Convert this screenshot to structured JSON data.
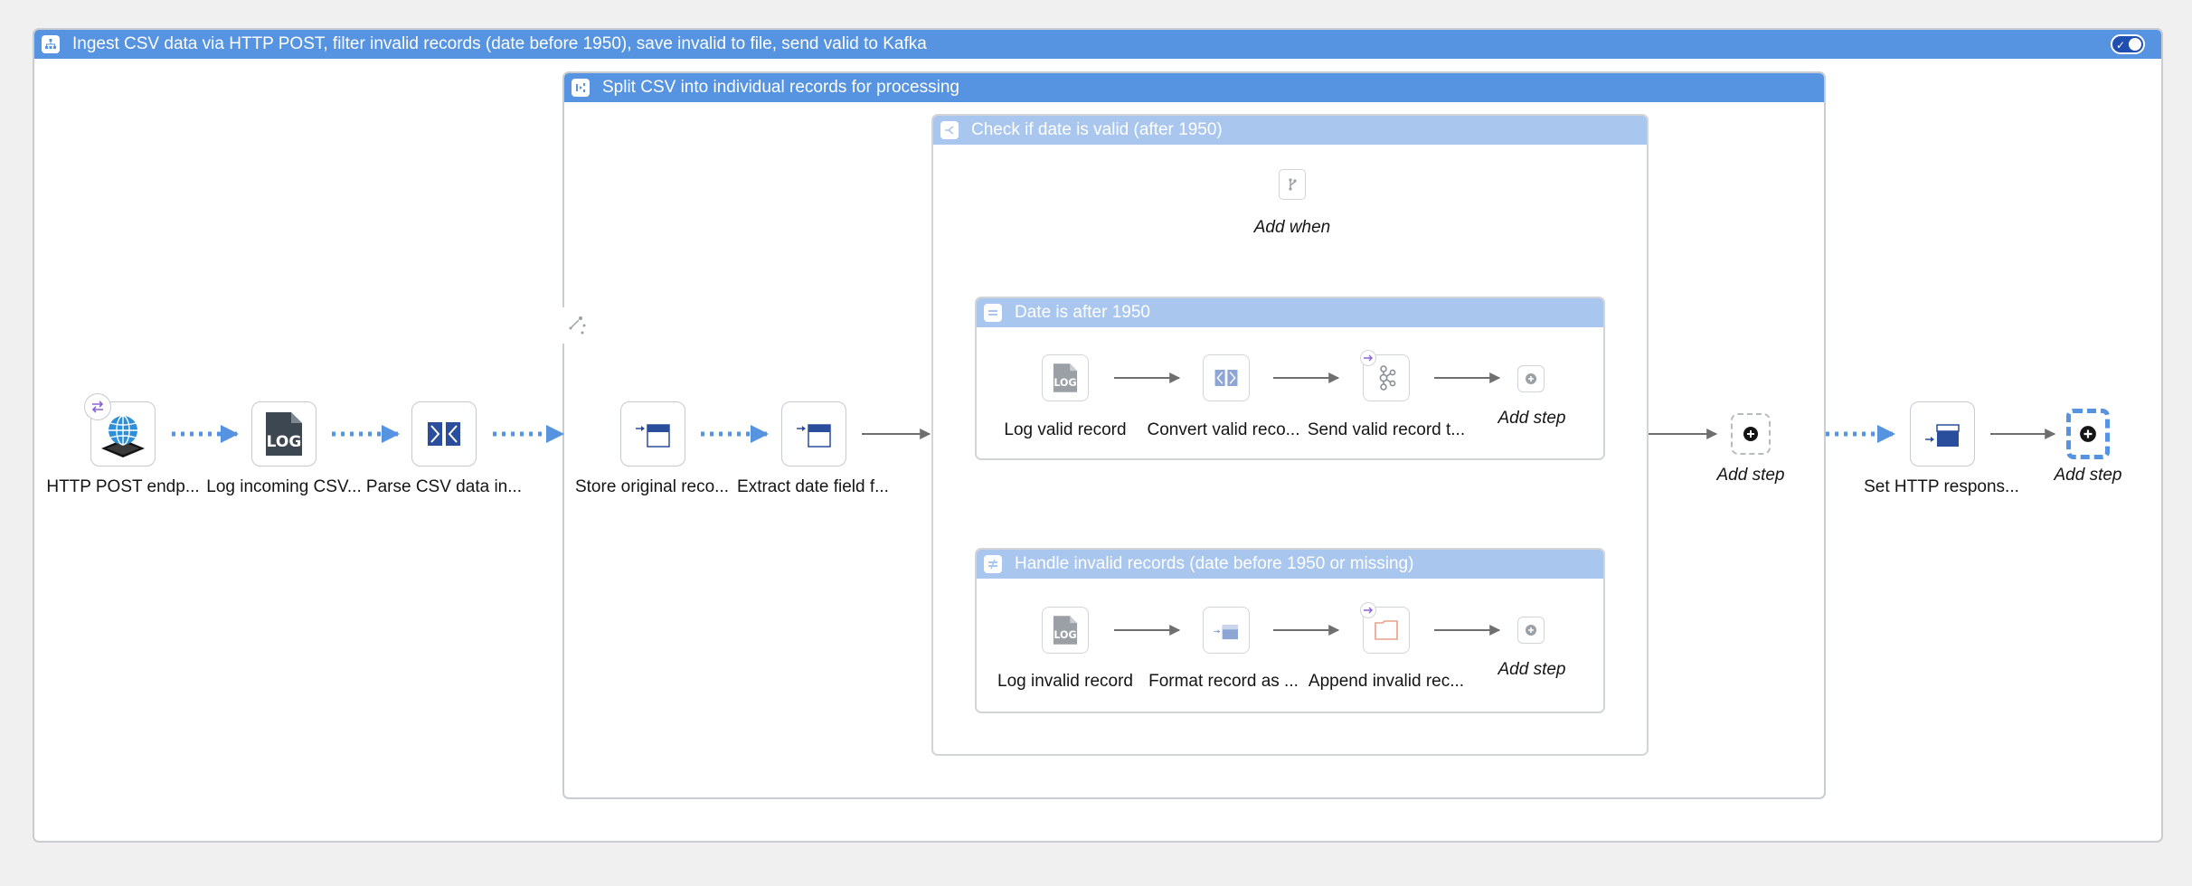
{
  "route": {
    "title": "Ingest CSV data via HTTP POST, filter invalid records (date before 1950), save invalid to file, send valid to Kafka",
    "toggle_check": "✓"
  },
  "split": {
    "title": "Split CSV into individual records for processing"
  },
  "choice": {
    "title": "Check if date is valid (after 1950)",
    "add_when": "Add when"
  },
  "when": {
    "title": "Date is after 1950",
    "steps": [
      "Log valid record",
      "Convert valid reco...",
      "Send valid record t..."
    ],
    "add_step": "Add step"
  },
  "otherwise": {
    "title": "Handle invalid records (date before 1950 or missing)",
    "steps": [
      "Log invalid record",
      "Format record as ...",
      "Append invalid rec..."
    ],
    "add_step": "Add step"
  },
  "main_steps": [
    "HTTP POST endp...",
    "Log incoming CSV...",
    "Parse CSV data in..."
  ],
  "split_steps": [
    "Store original reco...",
    "Extract date field f..."
  ],
  "after_choice_add_step": "Add step",
  "final_step": "Set HTTP respons...",
  "final_add_step": "Add step",
  "log_text": "LOG",
  "colors": {
    "header_dark": "#5693e0",
    "header_light": "#a9c6ee",
    "dotted_edge": "#5693e0",
    "solid_edge": "#6f6f6f",
    "toggle": "#1f4fb0"
  }
}
